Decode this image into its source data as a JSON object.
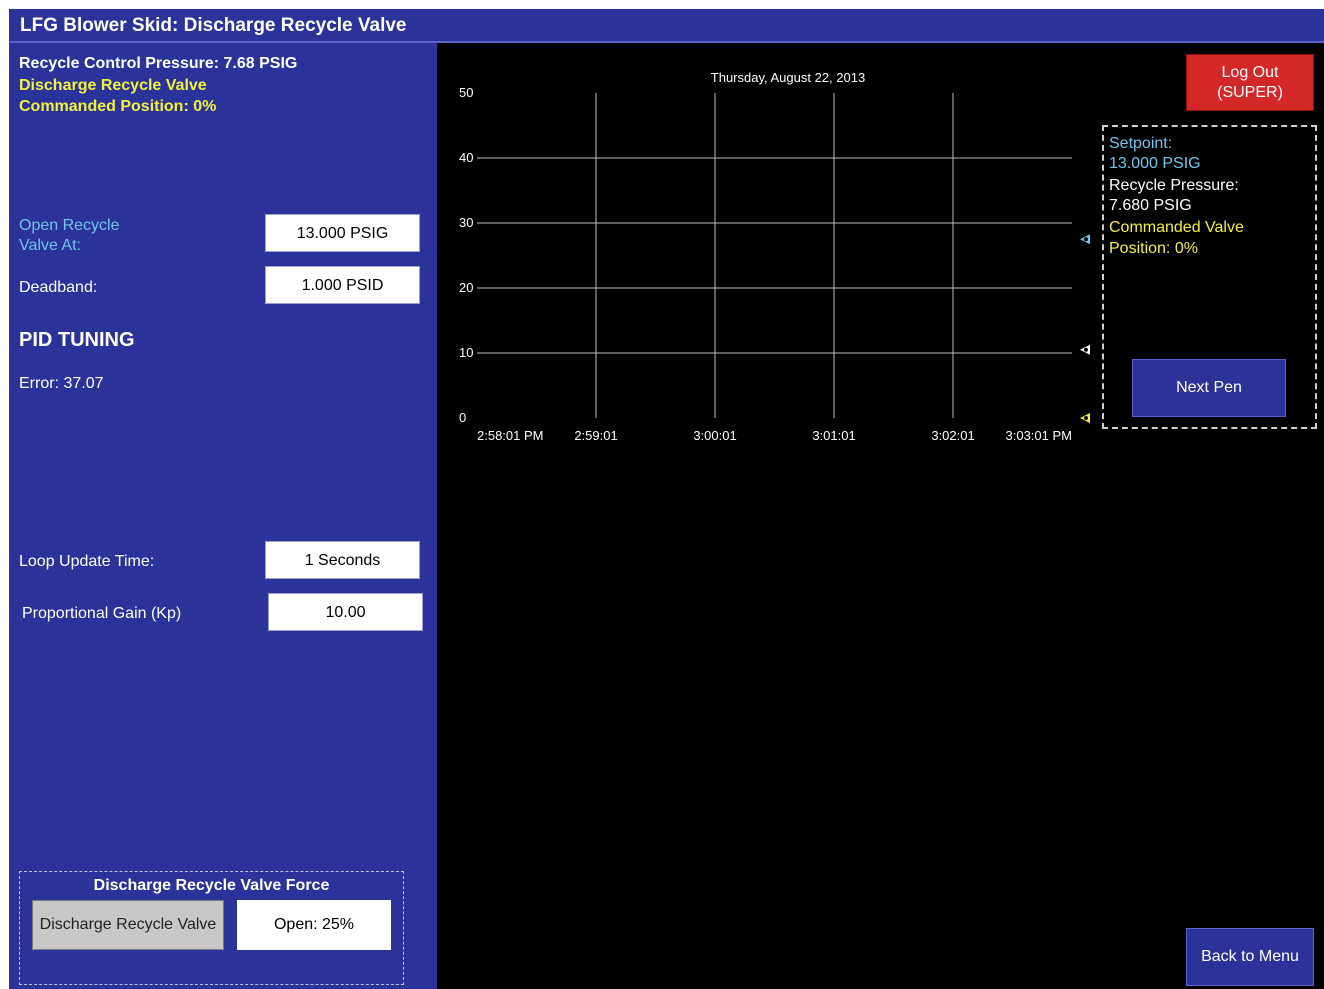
{
  "window": {
    "title": "LFG Blower Skid: Discharge Recycle Valve"
  },
  "status": {
    "control_pressure": "Recycle Control Pressure: 7.68 PSIG",
    "valve_line1": "Discharge Recycle Valve",
    "valve_line2": "Commanded Position: 0%"
  },
  "settings": {
    "open_at_label": "Open Recycle Valve At:",
    "open_at_value": "13.000 PSIG",
    "deadband_label": "Deadband:",
    "deadband_value": "1.000 PSID"
  },
  "pid": {
    "title": "PID TUNING",
    "error": "Error: 37.07",
    "loop_update_label": "Loop Update Time:",
    "loop_update_value": "1 Seconds",
    "kp_label": "Proportional Gain (Kp)",
    "kp_value": "10.00"
  },
  "force": {
    "title": "Discharge Recycle Valve Force",
    "button_label": "Discharge Recycle Valve",
    "value": "Open: 25%"
  },
  "buttons": {
    "logout_line1": "Log Out",
    "logout_line2": "(SUPER)",
    "next_pen": "Next Pen",
    "back_to_menu": "Back to Menu"
  },
  "legend": {
    "setpoint_label": "Setpoint:",
    "setpoint_value": "13.000 PSIG",
    "pressure_label": "Recycle Pressure:",
    "pressure_value": "7.680 PSIG",
    "valve_label": "Commanded Valve",
    "valve_value": "Position: 0%"
  },
  "chart_data": {
    "type": "line",
    "title": "Thursday, August 22, 2013",
    "ylim": [
      0,
      50
    ],
    "y_ticks": [
      0,
      10,
      20,
      30,
      40,
      50
    ],
    "x_ticks": [
      "2:58:01 PM",
      "2:59:01",
      "3:00:01",
      "3:01:01",
      "3:02:01",
      "3:03:01 PM"
    ],
    "grid": true,
    "series": [
      {
        "name": "Setpoint",
        "color": "#6fc6ea",
        "current": 27.5
      },
      {
        "name": "Recycle Pressure",
        "color": "#ffffff",
        "current": 10.5
      },
      {
        "name": "Commanded Valve Position",
        "color": "#f2f23c",
        "current": 0
      }
    ]
  },
  "colors": {
    "panel_blue": "#2b3299",
    "accent_yellow": "#f2f23c",
    "accent_cyan": "#6fc6ea",
    "logout_red": "#d42828"
  }
}
